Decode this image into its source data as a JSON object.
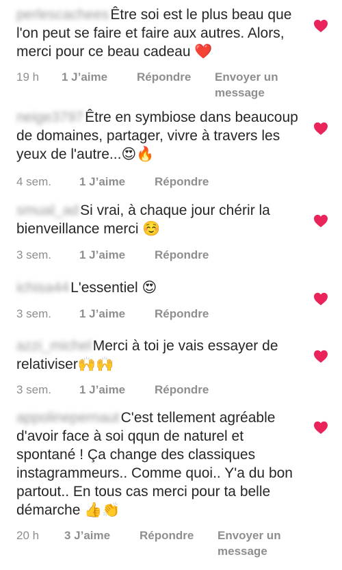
{
  "colors": {
    "heart": "#e8245a",
    "text": "#262626",
    "meta": "#8e8e8e"
  },
  "comments": [
    {
      "username": "perlescachees",
      "text": "Être soi est le plus beau que l'on peut se faire et faire aux autres. Alors, merci pour ce beau cadeau ❤️",
      "time": "19 h",
      "likes": "1 J’aime",
      "reply": "Répondre",
      "send": "Envoyer un message",
      "liked": true
    },
    {
      "username": "neige3797",
      "text": "Être en symbiose dans beaucoup de domaines, partager, vivre à travers les yeux de l'autre...😍🔥",
      "time": "4 sem.",
      "likes": "1 J’aime",
      "reply": "Répondre",
      "liked": true
    },
    {
      "username": "smual_ad",
      "text": "Si vrai, à chaque jour chérir la bienveillance merci ☺️",
      "time": "3 sem.",
      "likes": "1 J’aime",
      "reply": "Répondre",
      "liked": true
    },
    {
      "username": "ichisa44",
      "text": "L'essentiel 😍",
      "time": "3 sem.",
      "likes": "1 J’aime",
      "reply": "Répondre",
      "liked": true
    },
    {
      "username": "azzi_michel",
      "text": "Merci à toi je vais essayer de relativiser🙌🙌",
      "time": "3 sem.",
      "likes": "1 J’aime",
      "reply": "Répondre",
      "liked": true
    },
    {
      "username": "appolinepernaut",
      "text": "C'est tellement agréable d'avoir face à soi qqun de naturel et spontané ! Ça change des classiques instagrammeurs.. Comme quoi.. Y'a du bon partout.. En tous cas merci pour ta belle démarche 👍👏",
      "time": "20 h",
      "likes": "3 J’aime",
      "reply": "Répondre",
      "send": "Envoyer un message",
      "liked": true
    }
  ]
}
